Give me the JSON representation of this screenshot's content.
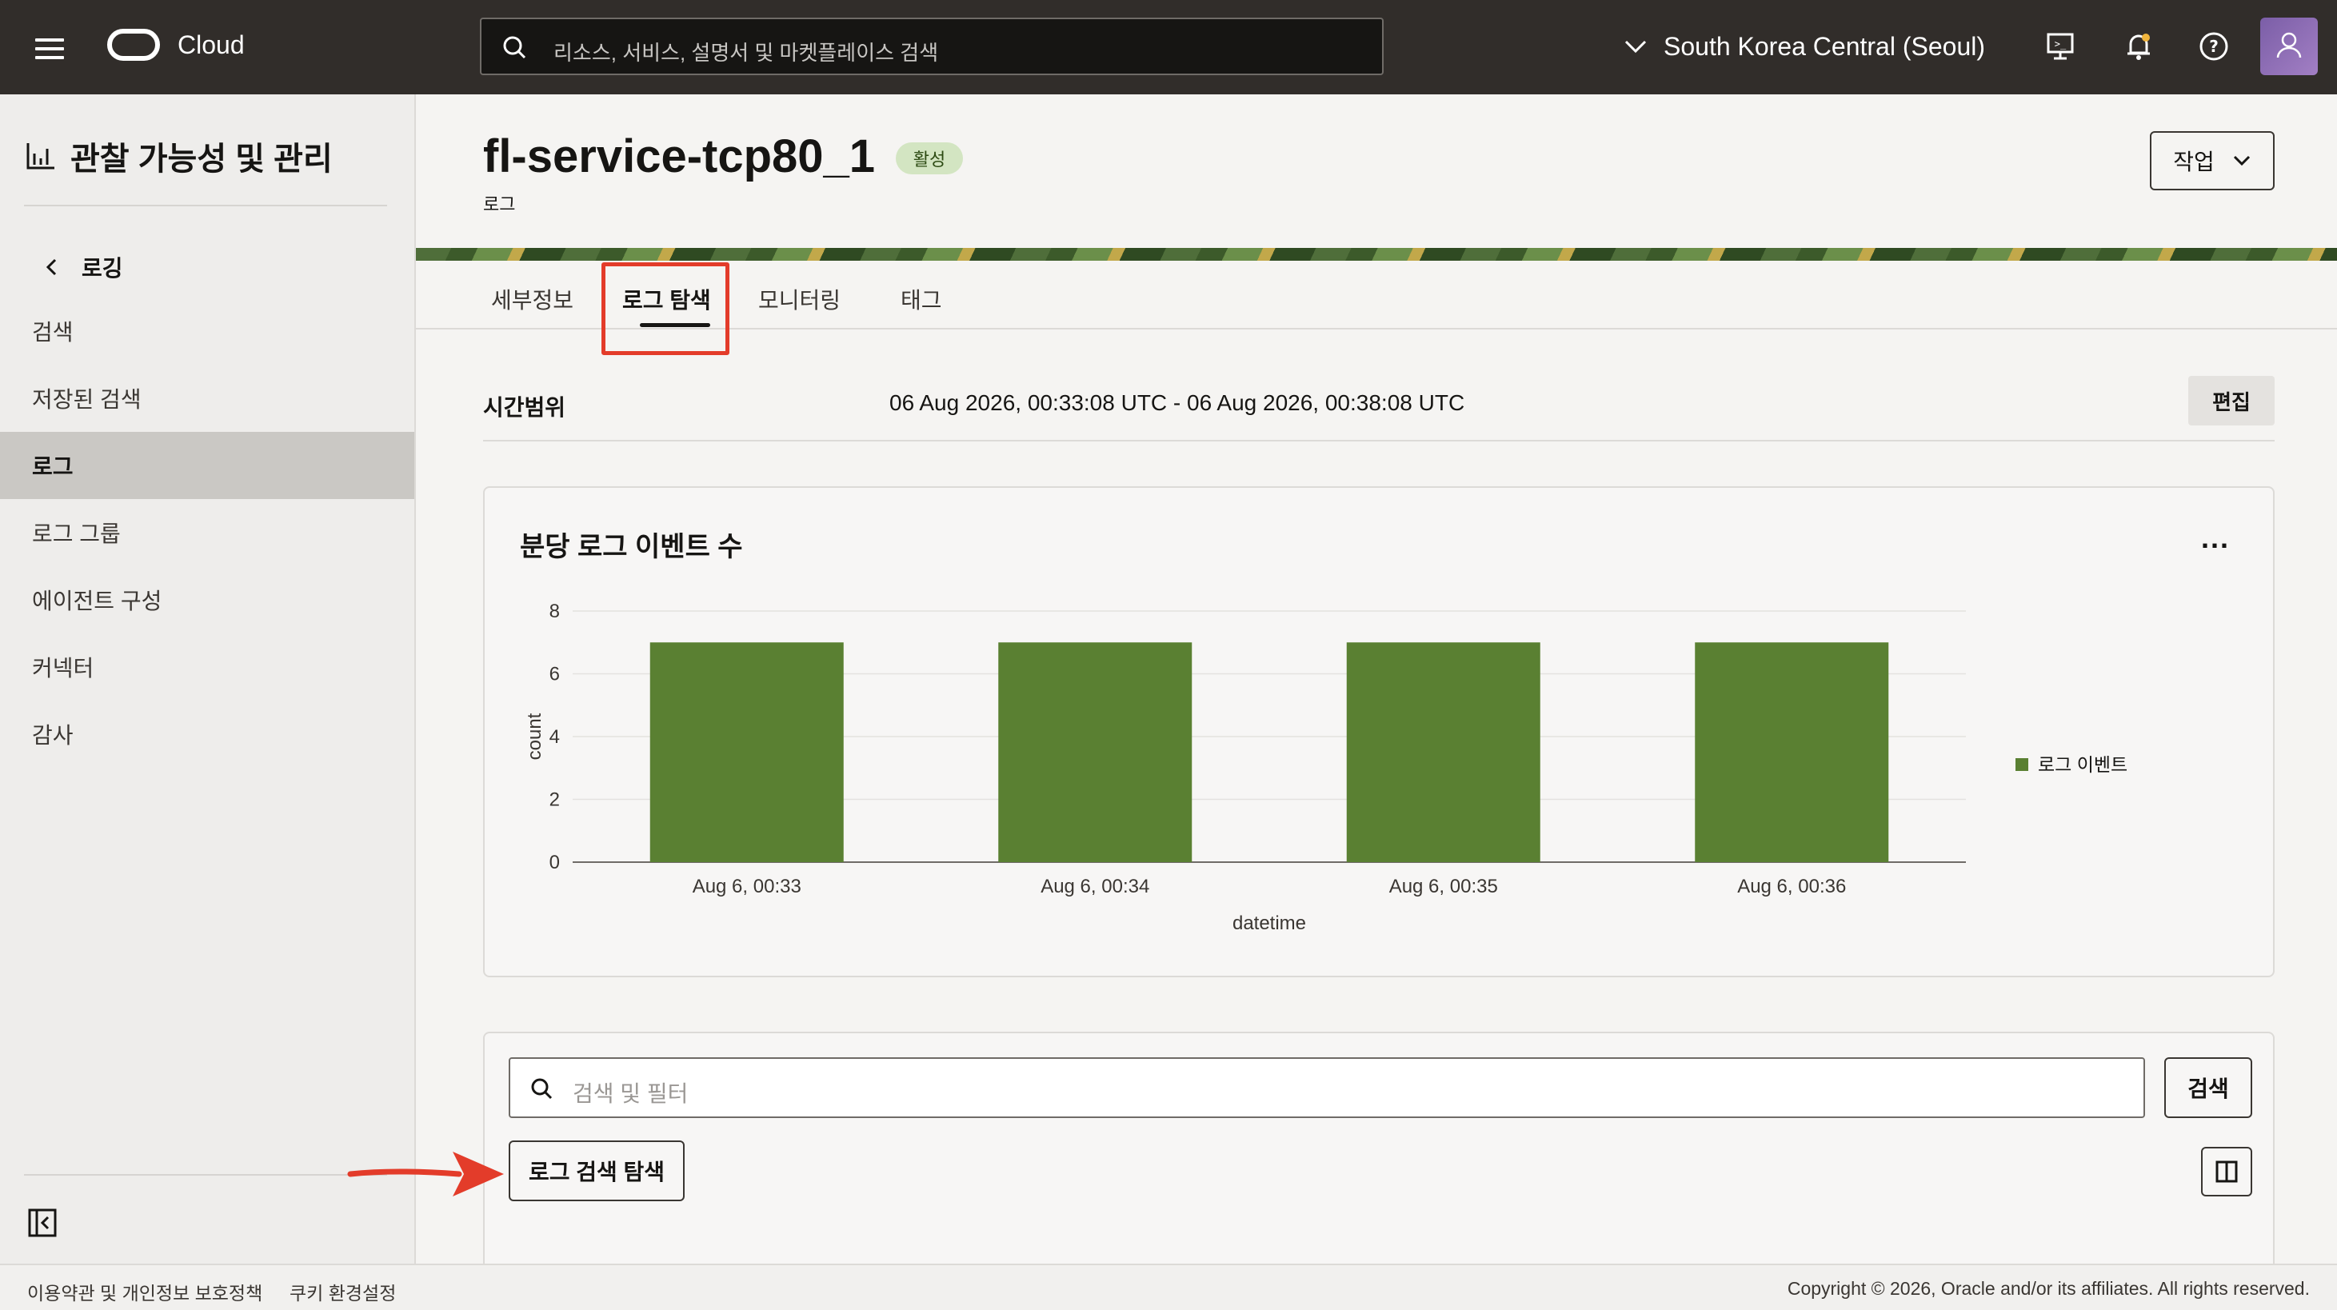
{
  "header": {
    "brand": "Cloud",
    "search_placeholder": "리소스, 서비스, 설명서 및 마켓플레이스 검색",
    "region": "South Korea Central (Seoul)"
  },
  "sidebar": {
    "title": "관찰 가능성 및 관리",
    "back_label": "로깅",
    "items": [
      {
        "label": "검색"
      },
      {
        "label": "저장된 검색"
      },
      {
        "label": "로그"
      },
      {
        "label": "로그 그룹"
      },
      {
        "label": "에이전트 구성"
      },
      {
        "label": "커넥터"
      },
      {
        "label": "감사"
      }
    ],
    "active_item": "로그"
  },
  "page": {
    "title": "fl-service-tcp80_1",
    "status": "활성",
    "subtitle": "로그",
    "action_label": "작업"
  },
  "tabs": [
    {
      "label": "세부정보"
    },
    {
      "label": "로그 탐색"
    },
    {
      "label": "모니터링"
    },
    {
      "label": "태그"
    }
  ],
  "active_tab": "로그 탐색",
  "time_range": {
    "label": "시간범위",
    "value": "06 Aug 2026, 00:33:08 UTC - 06 Aug 2026, 00:38:08 UTC",
    "edit_label": "편집"
  },
  "chart_card": {
    "title": "분당 로그 이벤트 수",
    "more_label": "..."
  },
  "chart_data": {
    "type": "bar",
    "categories": [
      "Aug 6, 00:33",
      "Aug 6, 00:34",
      "Aug 6, 00:35",
      "Aug 6, 00:36"
    ],
    "series": [
      {
        "name": "로그 이벤트",
        "values": [
          7,
          7,
          7,
          7
        ],
        "color": "#5a8032"
      }
    ],
    "xlabel": "datetime",
    "ylabel": "count",
    "ylim": [
      0,
      8
    ],
    "yticks": [
      0,
      2,
      4,
      6,
      8
    ],
    "grid": true,
    "legend": "right"
  },
  "search_card": {
    "filter_placeholder": "검색 및 필터",
    "search_label": "검색",
    "explore_label": "로그 검색 탐색"
  },
  "footer": {
    "terms": "이용약관 및 개인정보 보호정책",
    "cookies": "쿠키 환경설정",
    "copyright": "Copyright © 2026, Oracle and/or its affiliates. All rights reserved."
  },
  "colors": {
    "header_bg": "#312d2a",
    "bar": "#5a8032",
    "status_bg": "#d3e5c2",
    "annotation": "#e33c2a"
  }
}
